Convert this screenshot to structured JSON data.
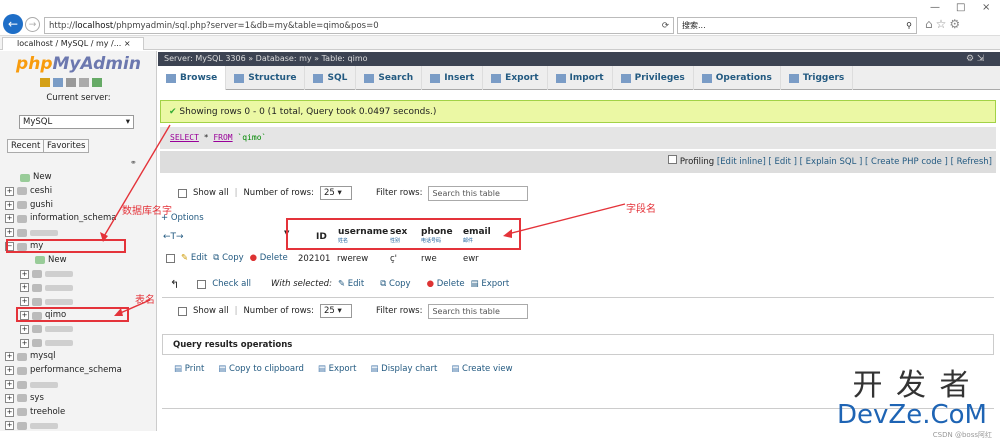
{
  "browser": {
    "url_prefix": "http://",
    "url_host": "localhost",
    "url_rest": "/phpmyadmin/sql.php?server=1&db=my&table=qimo&pos=0",
    "search_placeholder": "搜索...",
    "tab_title": "localhost / MySQL / my /...",
    "tab_close": "×",
    "win_min": "—",
    "win_max": "□",
    "win_close": "×"
  },
  "nav": {
    "logo_php": "php",
    "logo_admin": "MyAdmin",
    "current_server": "Current server:",
    "server_select": "MySQL",
    "recent": "Recent",
    "favorites": "Favorites",
    "tree": [
      {
        "label": "New",
        "new": true
      },
      {
        "label": "ceshi"
      },
      {
        "label": "gushi"
      },
      {
        "label": "information_schema"
      },
      {
        "label": "",
        "blur": true
      },
      {
        "label": "my",
        "open": true
      },
      {
        "label": "New",
        "new": true,
        "child": true
      },
      {
        "label": "",
        "blur": true,
        "child": true
      },
      {
        "label": "",
        "blur": true,
        "child": true
      },
      {
        "label": "",
        "blur": true,
        "child": true
      },
      {
        "label": "qimo",
        "child": true
      },
      {
        "label": "",
        "blur": true,
        "child": true
      },
      {
        "label": "",
        "blur": true,
        "child": true
      },
      {
        "label": "mysql"
      },
      {
        "label": "performance_schema"
      },
      {
        "label": "",
        "blur": true
      },
      {
        "label": "sys"
      },
      {
        "label": "treehole"
      },
      {
        "label": "",
        "blur": true
      }
    ]
  },
  "breadcrumb": "Server: MySQL 3306 » Database: my » Table: qimo",
  "tabs": [
    "Browse",
    "Structure",
    "SQL",
    "Search",
    "Insert",
    "Export",
    "Import",
    "Privileges",
    "Operations",
    "Triggers"
  ],
  "success": "Showing rows 0 - 0 (1 total, Query took 0.0497 seconds.)",
  "sql": {
    "kw1": "SELECT",
    "mid": " * ",
    "kw2": "FROM",
    "tbl": " `qimo`"
  },
  "profiling": {
    "label": "Profiling",
    "links": "[Edit inline] [ Edit ] [ Explain SQL ] [ Create PHP code ] [ Refresh]"
  },
  "controls": {
    "show_all": "Show all",
    "num_rows_label": "Number of rows:",
    "num_rows": "25",
    "filter_label": "Filter rows:",
    "filter_placeholder": "Search this table",
    "options": "+ Options"
  },
  "columns": [
    {
      "name": "ID",
      "comment": ""
    },
    {
      "name": "username",
      "comment": "姓名"
    },
    {
      "name": "sex",
      "comment": "性别"
    },
    {
      "name": "phone",
      "comment": "电话号码"
    },
    {
      "name": "email",
      "comment": "邮件"
    }
  ],
  "row": {
    "edit": "Edit",
    "copy": "Copy",
    "delete": "Delete",
    "values": [
      "202101",
      "rwerew",
      "ç'",
      "rwe",
      "ewr"
    ]
  },
  "bulk": {
    "check_all": "Check all",
    "with_selected": "With selected:",
    "edit": "Edit",
    "copy": "Copy",
    "delete": "Delete",
    "export": "Export"
  },
  "query_ops": {
    "title": "Query results operations",
    "items": [
      "Print",
      "Copy to clipboard",
      "Export",
      "Display chart",
      "Create view"
    ]
  },
  "annotations": {
    "db_name": "数据库名字",
    "field_name": "字段名",
    "table_name": "表名"
  },
  "watermark": {
    "cn": "开 发 者",
    "en": "DevZe.CoM",
    "credit": "CSDN @boss阿红"
  }
}
